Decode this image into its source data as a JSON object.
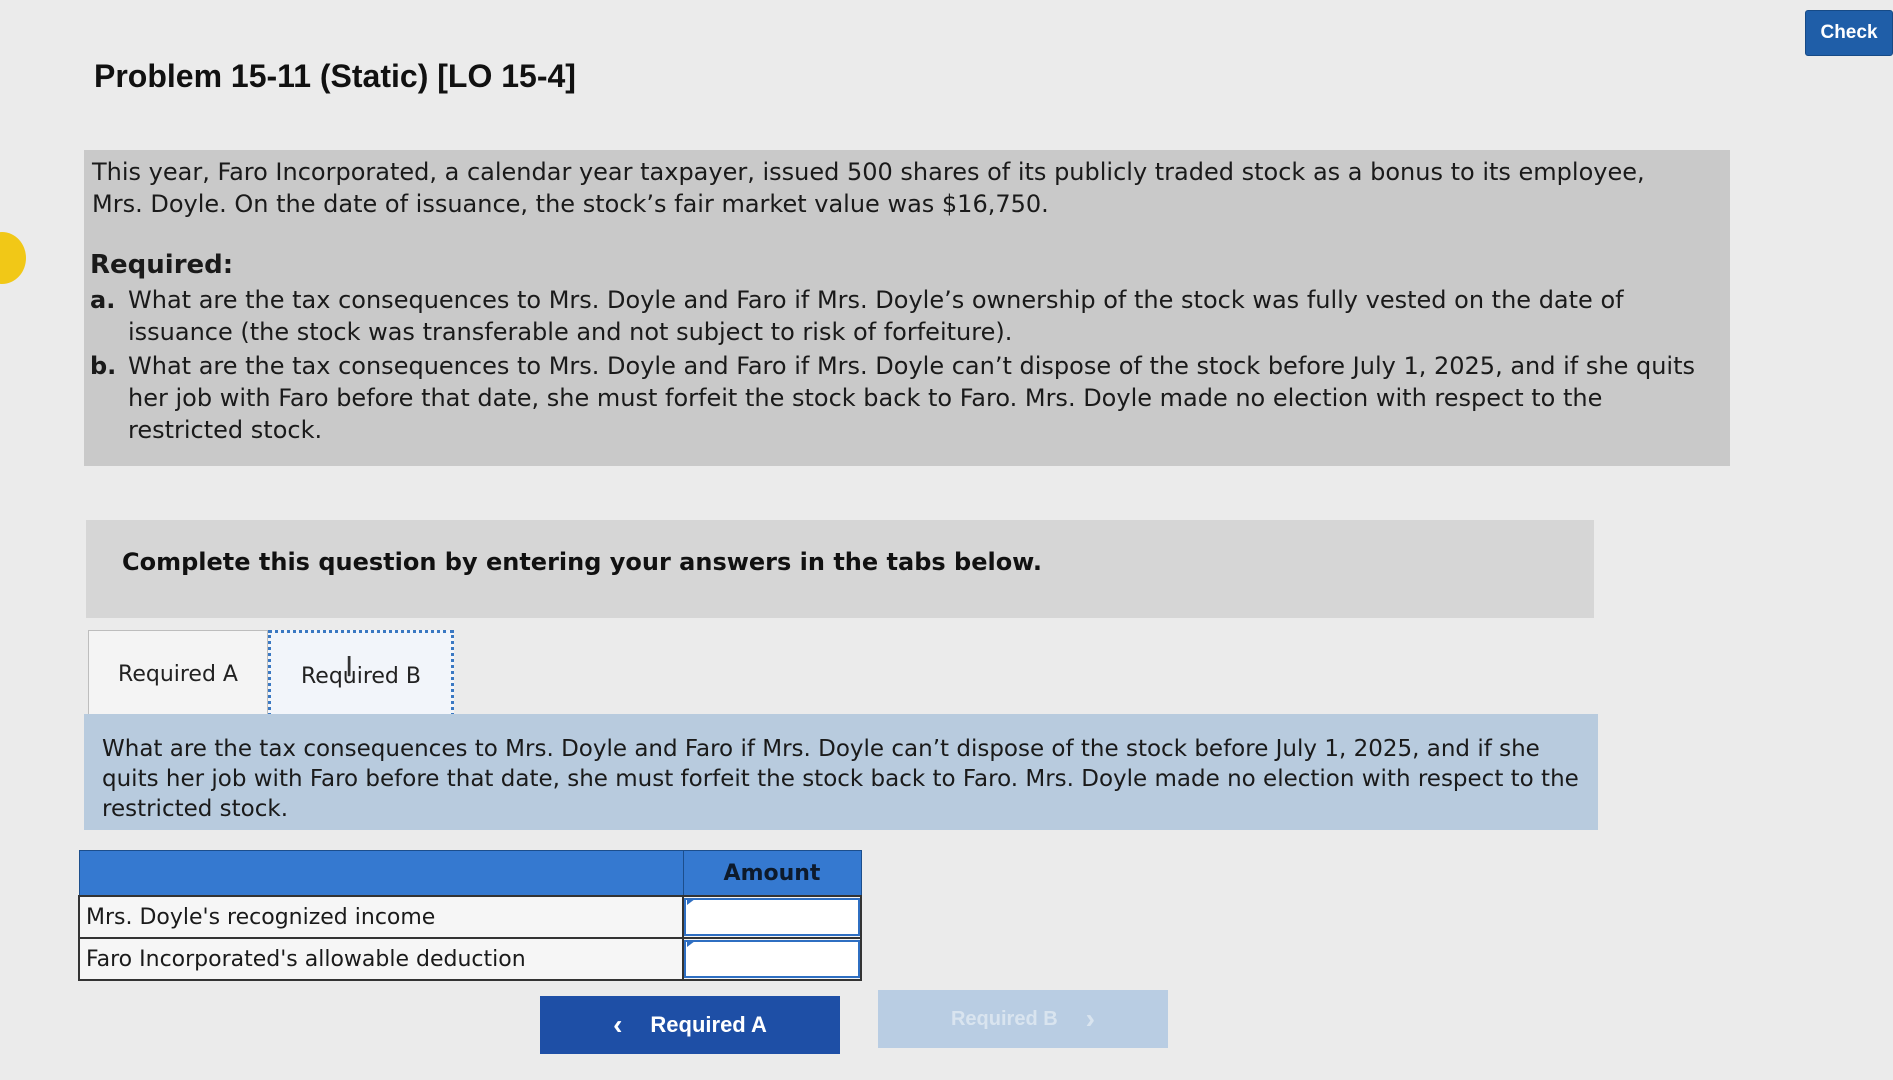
{
  "header": {
    "check_label": "Check"
  },
  "problem": {
    "title": "Problem 15-11 (Static) [LO 15-4]",
    "intro": "This year, Faro Incorporated, a calendar year taxpayer, issued 500 shares of its publicly traded stock as a bonus to its employee, Mrs. Doyle. On the date of issuance, the stock’s fair market value was $16,750.",
    "required_heading": "Required:",
    "items": [
      {
        "letter": "a.",
        "text": "What are the tax consequences to Mrs. Doyle and Faro if Mrs. Doyle’s ownership of the stock was fully vested on the date of issuance (the stock was transferable and not subject to risk of forfeiture)."
      },
      {
        "letter": "b.",
        "text": "What are the tax consequences to Mrs. Doyle and Faro if Mrs. Doyle can’t dispose of the stock before July 1, 2025, and if she quits her job with Faro before that date, she must forfeit the stock back to Faro. Mrs. Doyle made no election with respect to the restricted stock."
      }
    ]
  },
  "instruction": "Complete this question by entering your answers in the tabs below.",
  "tabs": [
    {
      "label": "Required A"
    },
    {
      "label": "Required B"
    }
  ],
  "question": "What are the tax consequences to Mrs. Doyle and Faro if Mrs. Doyle can’t dispose of the stock before July 1, 2025, and if she quits her job with Faro before that date, she must forfeit the stock back to Faro. Mrs. Doyle made no election with respect to the restricted stock.",
  "table": {
    "header_label": "",
    "header_amount": "Amount",
    "rows": [
      {
        "label": "Mrs. Doyle's recognized income",
        "value": ""
      },
      {
        "label": "Faro Incorporated's allowable deduction",
        "value": ""
      }
    ]
  },
  "nav": {
    "prev_label": "Required A",
    "next_label": "Required B"
  },
  "colors": {
    "accent": "#1e4fa6",
    "table_header": "#3579d0",
    "question_bg": "#b8cbde"
  }
}
